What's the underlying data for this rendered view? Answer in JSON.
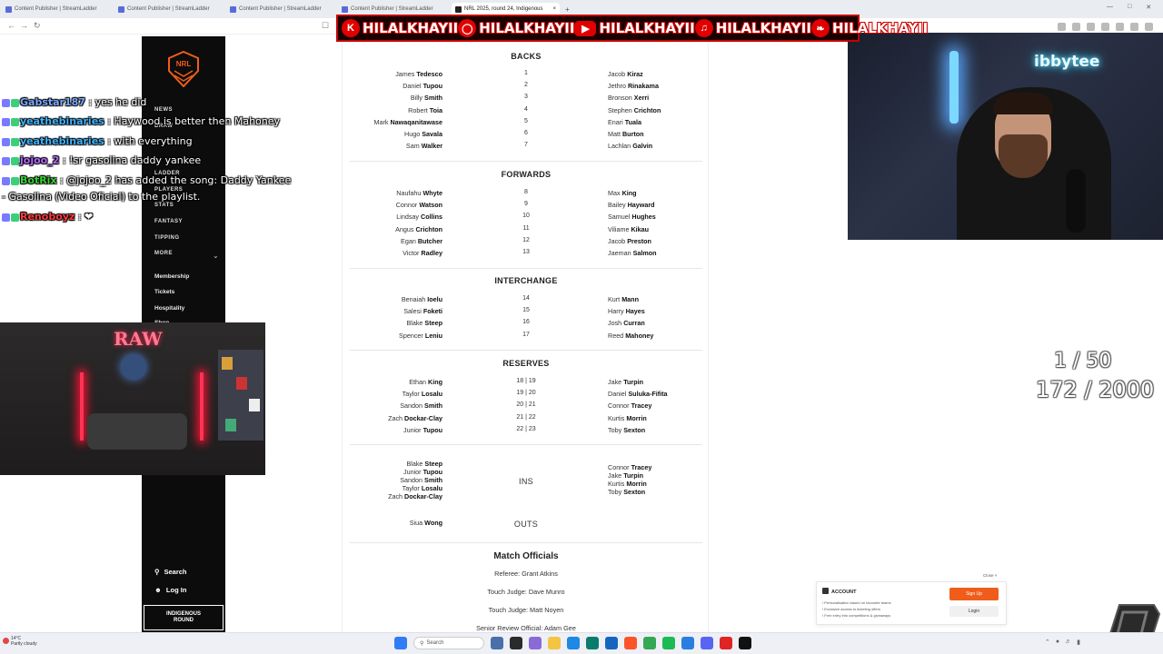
{
  "browser": {
    "tabs": [
      {
        "label": "Content Publisher | StreamLadder"
      },
      {
        "label": "Content Publisher | StreamLadder"
      },
      {
        "label": "Content Publisher | StreamLadder"
      },
      {
        "label": "Content Publisher | StreamLadder"
      },
      {
        "label": "NRL 2025, round 24, Indigenous"
      }
    ],
    "new_tab": "+",
    "close_tab": "×"
  },
  "banner": {
    "handles": [
      "HILALKHAYII",
      "HILALKHAYII",
      "HILALKHAYII",
      "HILALKHAYII",
      "HILALKHAYII"
    ],
    "icons": [
      "kick-icon",
      "instagram-icon",
      "youtube-icon",
      "tiktok-icon",
      "twitter-icon"
    ]
  },
  "sidebar": {
    "logo": "NRL",
    "nav": [
      "NEWS",
      "DRAW",
      "LADDER",
      "PLAYERS",
      "STATS",
      "FANTASY",
      "TIPPING",
      "MORE"
    ],
    "sub": [
      "Membership",
      "Tickets",
      "Hospitality",
      "Shop"
    ],
    "search": "Search",
    "login": "Log In",
    "indigenous_line1": "INDIGENOUS",
    "indigenous_line2": "ROUND"
  },
  "chat": [
    {
      "user": "Gabstar187",
      "sep": " : ",
      "msg": "yes he did",
      "color": "#7aa7ff"
    },
    {
      "user": "yeathebinaries",
      "sep": " : ",
      "msg": "Haywood is better then Mahoney",
      "color": "#3bb3ff"
    },
    {
      "user": "yeathebinaries",
      "sep": " : ",
      "msg": "with everything",
      "color": "#3bb3ff"
    },
    {
      "user": "jojoo_2",
      "sep": " : ",
      "msg": "!sr gasolina daddy yankee",
      "color": "#b566ff"
    },
    {
      "user": "BotRix",
      "sep": " : ",
      "msg": "@jojoo_2 has added the song: Daddy Yankee",
      "color": "#36d336"
    },
    {
      "user": "",
      "sep": "",
      "msg": "- Gasolina (Video Oficial) to the playlist.",
      "color": "#ffffff"
    },
    {
      "user": "Renoboyz",
      "sep": " : ",
      "msg": "❤",
      "color": "#ff3b3b"
    }
  ],
  "team": {
    "backs_title": "BACKS",
    "backs": [
      {
        "lf": "James",
        "ll": "Tedesco",
        "n": "1",
        "rf": "Jacob",
        "rl": "Kiraz"
      },
      {
        "lf": "Daniel",
        "ll": "Tupou",
        "n": "2",
        "rf": "Jethro",
        "rl": "Rinakama"
      },
      {
        "lf": "Billy",
        "ll": "Smith",
        "n": "3",
        "rf": "Bronson",
        "rl": "Xerri"
      },
      {
        "lf": "Robert",
        "ll": "Toia",
        "n": "4",
        "rf": "Stephen",
        "rl": "Crichton"
      },
      {
        "lf": "Mark",
        "ll": "Nawaqanitawase",
        "n": "5",
        "rf": "Enari",
        "rl": "Tuala"
      },
      {
        "lf": "Hugo",
        "ll": "Savala",
        "n": "6",
        "rf": "Matt",
        "rl": "Burton"
      },
      {
        "lf": "Sam",
        "ll": "Walker",
        "n": "7",
        "rf": "Lachlan",
        "rl": "Galvin"
      }
    ],
    "forwards_title": "FORWARDS",
    "forwards": [
      {
        "lf": "Naufahu",
        "ll": "Whyte",
        "n": "8",
        "rf": "Max",
        "rl": "King"
      },
      {
        "lf": "Connor",
        "ll": "Watson",
        "n": "9",
        "rf": "Bailey",
        "rl": "Hayward"
      },
      {
        "lf": "Lindsay",
        "ll": "Collins",
        "n": "10",
        "rf": "Samuel",
        "rl": "Hughes"
      },
      {
        "lf": "Angus",
        "ll": "Crichton",
        "n": "11",
        "rf": "Viliame",
        "rl": "Kikau"
      },
      {
        "lf": "Egan",
        "ll": "Butcher",
        "n": "12",
        "rf": "Jacob",
        "rl": "Preston"
      },
      {
        "lf": "Victor",
        "ll": "Radley",
        "n": "13",
        "rf": "Jaeman",
        "rl": "Salmon"
      }
    ],
    "interchange_title": "INTERCHANGE",
    "interchange": [
      {
        "lf": "Benaiah",
        "ll": "Ioelu",
        "n": "14",
        "rf": "Kurt",
        "rl": "Mann"
      },
      {
        "lf": "Salesi",
        "ll": "Foketi",
        "n": "15",
        "rf": "Harry",
        "rl": "Hayes"
      },
      {
        "lf": "Blake",
        "ll": "Steep",
        "n": "16",
        "rf": "Josh",
        "rl": "Curran"
      },
      {
        "lf": "Spencer",
        "ll": "Leniu",
        "n": "17",
        "rf": "Reed",
        "rl": "Mahoney"
      }
    ],
    "reserves_title": "RESERVES",
    "reserves": [
      {
        "lf": "Ethan",
        "ll": "King",
        "n": "18 | 19",
        "rf": "Jake",
        "rl": "Turpin"
      },
      {
        "lf": "Taylor",
        "ll": "Losalu",
        "n": "19 | 20",
        "rf": "Daniel",
        "rl": "Suluka-Fifita"
      },
      {
        "lf": "Sandon",
        "ll": "Smith",
        "n": "20 | 21",
        "rf": "Connor",
        "rl": "Tracey"
      },
      {
        "lf": "Zach",
        "ll": "Dockar-Clay",
        "n": "21 | 22",
        "rf": "Kurtis",
        "rl": "Morrin"
      },
      {
        "lf": "Junior",
        "ll": "Tupou",
        "n": "22 | 23",
        "rf": "Toby",
        "rl": "Sexton"
      }
    ],
    "ins_label": "INS",
    "ins_left": [
      {
        "f": "Blake",
        "l": "Steep"
      },
      {
        "f": "Junior",
        "l": "Tupou"
      },
      {
        "f": "Sandon",
        "l": "Smith"
      },
      {
        "f": "Taylor",
        "l": "Losalu"
      },
      {
        "f": "Zach",
        "l": "Dockar-Clay"
      }
    ],
    "ins_right": [
      {
        "f": "Connor",
        "l": "Tracey"
      },
      {
        "f": "Jake",
        "l": "Turpin"
      },
      {
        "f": "Kurtis",
        "l": "Morrin"
      },
      {
        "f": "Toby",
        "l": "Sexton"
      }
    ],
    "outs_label": "OUTS",
    "outs_left": {
      "f": "Siua",
      "l": "Wong"
    },
    "officials_title": "Match Officials",
    "officials": [
      "Referee: Grant Atkins",
      "Touch Judge: Dave Munro",
      "Touch Judge: Matt Noyen",
      "Senior Review Official: Adam Gee"
    ]
  },
  "webcam": {
    "sign": "ibbytee",
    "room_sign": "RAW"
  },
  "counters": {
    "a": "1 / 50",
    "b": "172 / 2000"
  },
  "account": {
    "close": "Close ×",
    "title": "ACCOUNT",
    "lines": [
      "/ Personalisation based on favourite teams",
      "/ Exclusive access to ticketing offers",
      "/ Free entry into competitions & giveaways"
    ],
    "signup": "Sign Up",
    "login": "Login"
  },
  "taskbar": {
    "temp": "14°C",
    "weather": "Partly cloudy",
    "search": "Search"
  },
  "colors": {
    "accent": "#f05d1a",
    "banner_red": "#e00000",
    "nrl_bg": "#0c0c0c"
  }
}
